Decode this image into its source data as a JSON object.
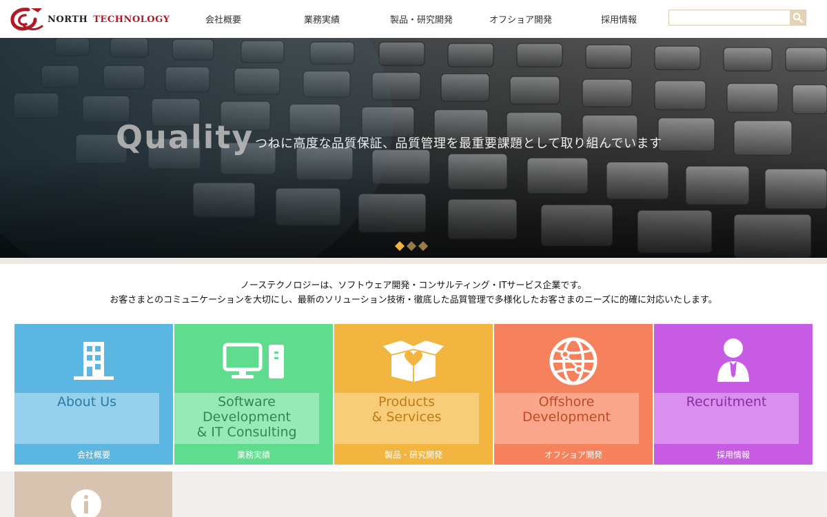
{
  "header": {
    "logo": {
      "north": "NORTH",
      "technology": "TECHNOLOGY"
    },
    "nav": [
      {
        "label": "会社概要"
      },
      {
        "label": "業務実績"
      },
      {
        "label": "製品・研究開発"
      },
      {
        "label": "オフショア開発"
      },
      {
        "label": "採用情報"
      }
    ],
    "search": {
      "value": "",
      "placeholder": "",
      "icon": "search-icon"
    }
  },
  "hero": {
    "word": "Quality",
    "caption": "つねに高度な品質保証、品質管理を最重要課題として取り組んでいます",
    "slides": [
      {
        "active": true,
        "color": "#f2b33d"
      },
      {
        "active": false,
        "color": "#9a7a48"
      },
      {
        "active": false,
        "color": "#9a7a48"
      }
    ]
  },
  "intro": {
    "line1": "ノーステクノロジーは、ソフトウェア開発・コンサルティング・ITサービス企業です。",
    "line2": "お客さまとのコミュニケーションを大切にし、最新のソリューション技術・徹底した品質管理で多様化したお客さまのニーズに的確に対応いたします。"
  },
  "tiles": [
    {
      "id": "about",
      "title": "About Us",
      "footer": "会社概要",
      "icon": "building-icon",
      "color": "#5bb7e2",
      "panel": "#95d0ec",
      "text": "#2a79a8"
    },
    {
      "id": "software",
      "title": "Software\nDevelopment\n& IT Consulting",
      "footer": "業務実績",
      "icon": "computer-icon",
      "color": "#5fdc8e",
      "panel": "#97e9b6",
      "text": "#2d8a4e"
    },
    {
      "id": "products",
      "title": "Products\n& Services",
      "footer": "製品・研究開発",
      "icon": "gift-box-icon",
      "color": "#f2b53f",
      "panel": "#f7cd79",
      "text": "#c37a14"
    },
    {
      "id": "offshore",
      "title": "Offshore\nDevelopment",
      "footer": "オフショア開発",
      "icon": "globe-icon",
      "color": "#f6825d",
      "panel": "#f9a68a",
      "text": "#c04a25"
    },
    {
      "id": "recruit",
      "title": "Recruitment",
      "footer": "採用情報",
      "icon": "person-icon",
      "color": "#c75be4",
      "panel": "#da8fee",
      "text": "#8a2aa6"
    }
  ],
  "info_tile": {
    "icon": "info-icon",
    "color": "#d8c3b0"
  }
}
